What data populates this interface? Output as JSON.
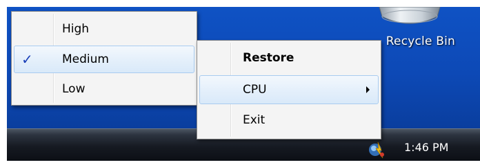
{
  "desktop": {
    "recycle_bin_label": "Recycle Bin",
    "background_color": "#0d49b6"
  },
  "taskbar": {
    "clock": "1:46 PM",
    "tray_icon": "cpu-monitor-tray-icon"
  },
  "priority_submenu": {
    "items": [
      {
        "label": "High",
        "checked": false
      },
      {
        "label": "Medium",
        "checked": true
      },
      {
        "label": "Low",
        "checked": false
      }
    ],
    "check_glyph": "✓",
    "check_color": "#1a3fb8"
  },
  "context_menu": {
    "items": [
      {
        "label": "Restore",
        "bold": true
      },
      {
        "label": "CPU",
        "has_submenu": true
      },
      {
        "label": "Exit"
      }
    ],
    "highlight_color": "#d9e9f9"
  }
}
